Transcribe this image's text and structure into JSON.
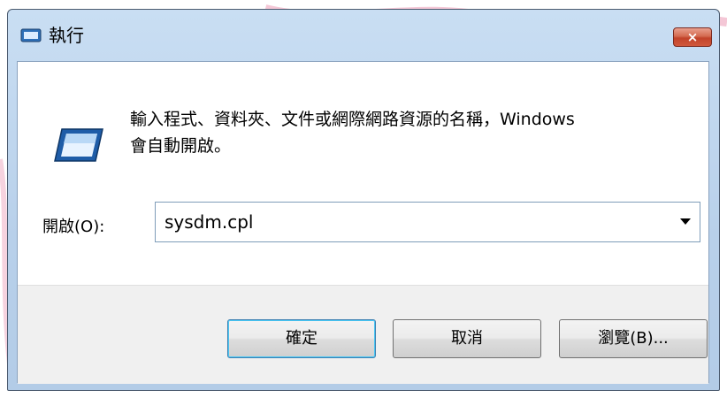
{
  "window": {
    "title": "執行",
    "close_label": "×"
  },
  "prompt": {
    "line1": "輸入程式、資料夾、文件或網際網路資源的名稱，Windows",
    "line2": "會自動開啟。"
  },
  "open_field": {
    "label": "開啟(O):",
    "value": "sysdm.cpl"
  },
  "buttons": {
    "ok": "確定",
    "cancel": "取消",
    "browse": "瀏覽(B)..."
  },
  "colors": {
    "titlebar": "#c9def3",
    "close_button": "#c2432a",
    "footer": "#f0f0f0",
    "default_button_border": "#3c7fb1"
  }
}
